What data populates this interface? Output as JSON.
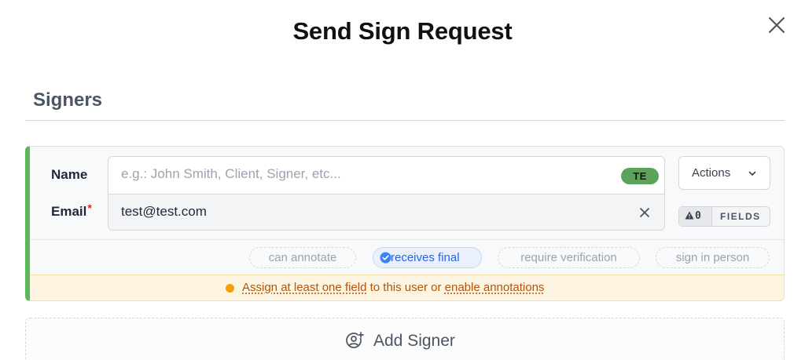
{
  "modal": {
    "title": "Send Sign Request",
    "close_icon": "close-icon"
  },
  "signers_section": {
    "title": "Signers"
  },
  "signer": {
    "name_label": "Name",
    "name_placeholder": "e.g.: John Smith, Client, Signer, etc...",
    "name_value": "",
    "initials_badge": "TE",
    "email_label": "Email",
    "email_required_mark": "*",
    "email_value": "test@test.com",
    "actions_label": "Actions",
    "fields_warning_count": "0",
    "fields_label": "FIELDS",
    "options": {
      "can_annotate": "can annotate",
      "receives_final": "receives final",
      "require_verification": "require verification",
      "sign_in_person": "sign in person"
    },
    "receives_final_selected": true,
    "warning": {
      "link1": "Assign at least one field",
      "middle": " to this user or ",
      "link2": "enable annotations"
    }
  },
  "add_signer": {
    "label": "Add Signer",
    "icon": "add-user-icon"
  },
  "colors": {
    "accent_green": "#5cb65a",
    "selected_blue": "#2563eb",
    "warning_orange": "#f59e0b",
    "required_red": "#dc2626"
  }
}
